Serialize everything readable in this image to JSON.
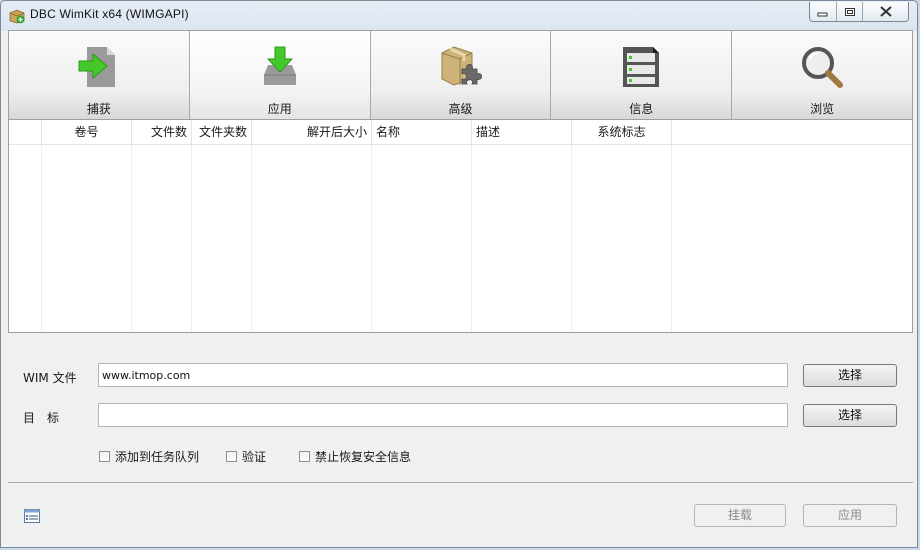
{
  "window": {
    "title": "DBC WimKit x64 (WIMGAPI)",
    "controls": [
      "minimize-icon",
      "maximize-icon",
      "close-icon"
    ]
  },
  "toolbar": {
    "items": [
      {
        "label": "捕获",
        "icon": "capture-icon",
        "active": false
      },
      {
        "label": "应用",
        "icon": "apply-icon",
        "active": true
      },
      {
        "label": "高级",
        "icon": "advanced-icon",
        "active": false
      },
      {
        "label": "信息",
        "icon": "info-icon",
        "active": false
      },
      {
        "label": "浏览",
        "icon": "browse-icon",
        "active": false
      }
    ]
  },
  "table": {
    "columns": [
      "",
      "卷号",
      "文件数",
      "文件夹数",
      "解开后大小",
      "名称",
      "描述",
      "系统标志",
      ""
    ],
    "rows": []
  },
  "form": {
    "wim_label": "WIM 文件",
    "wim_value": "www.itmop.com",
    "target_label": "目　标",
    "target_value": "",
    "select_label": "选择",
    "options": [
      {
        "label": "添加到任务队列",
        "checked": false
      },
      {
        "label": "验证",
        "checked": false
      },
      {
        "label": "禁止恢复安全信息",
        "checked": false
      }
    ]
  },
  "footer": {
    "mount_label": "挂载",
    "apply_label": "应用",
    "status_icon": "task-list-icon"
  },
  "colors": {
    "accent_green": "#44c82a",
    "chrome_blue": "#dbe5f0",
    "panel_gray": "#f0f0f0"
  }
}
